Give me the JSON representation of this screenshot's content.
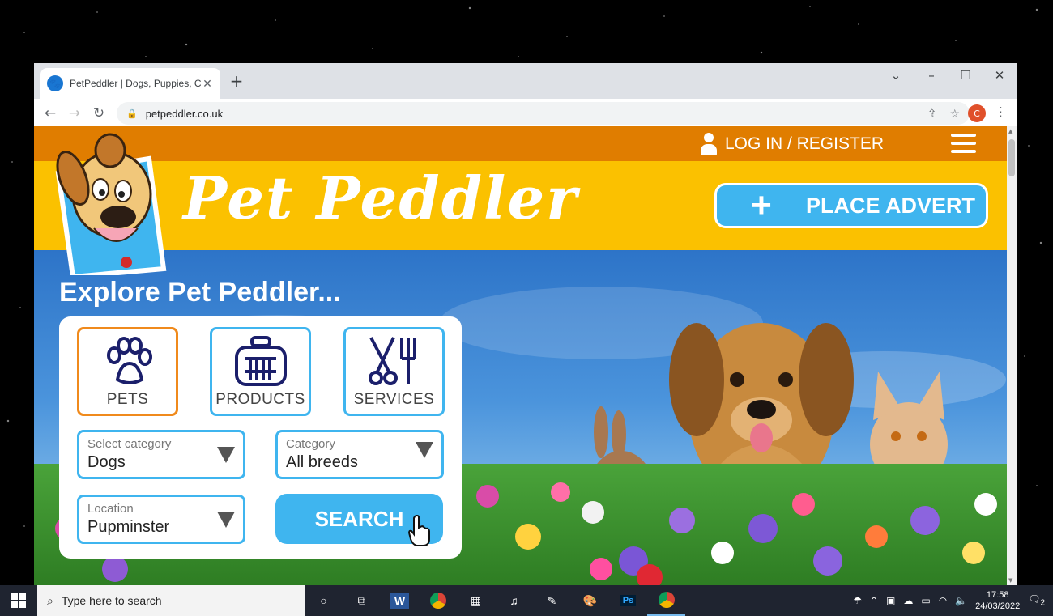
{
  "browser": {
    "tab_title": "PetPeddler | Dogs, Puppies, Cat",
    "url": "petpeddler.co.uk",
    "profile_initial": "C"
  },
  "site": {
    "login": "LOG IN / REGISTER",
    "brand": "Pet Peddler",
    "place_advert": "PLACE ADVERT",
    "explore_heading": "Explore Pet Peddler...",
    "categories": [
      {
        "label": "PETS",
        "active": true
      },
      {
        "label": "PRODUCTS",
        "active": false
      },
      {
        "label": "SERVICES",
        "active": false
      }
    ],
    "fields": {
      "category": {
        "label": "Select category",
        "value": "Dogs"
      },
      "breed": {
        "label": "Category",
        "value": "All breeds"
      },
      "location": {
        "label": "Location",
        "value": "Pupminster"
      }
    },
    "search_label": "SEARCH",
    "colors": {
      "orange": "#e07d00",
      "yellow": "#fbc100",
      "accent": "#3fb5ef",
      "active_border": "#f08a1c"
    }
  },
  "taskbar": {
    "search_placeholder": "Type here to search",
    "time": "17:58",
    "date": "24/03/2022",
    "notification_count": "2"
  }
}
